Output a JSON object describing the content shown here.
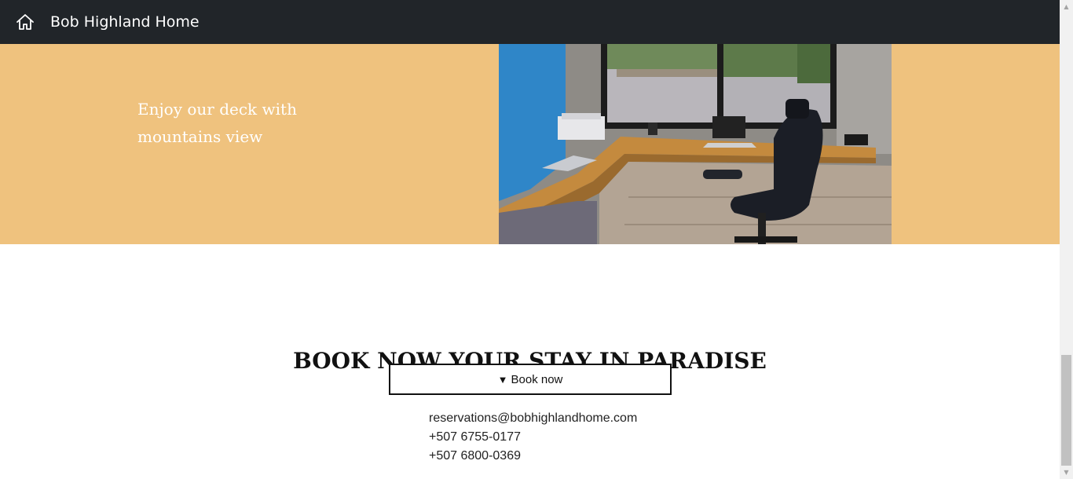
{
  "navbar": {
    "brand": "Bob Highland Home",
    "home_icon": "home-icon",
    "background": "#212529"
  },
  "feature": {
    "text": "Enjoy our deck with mountains view",
    "background": "#efc27e",
    "image": "photo of a home office desk with a black office chair by a window"
  },
  "booking": {
    "title": "BOOK NOW YOUR STAY IN PARADISE",
    "button_caret": "▼",
    "button_label": "Book now"
  },
  "contact": {
    "email": "reservations@bobhighlandhome.com",
    "phone_1": "+507 6755-0177",
    "phone_2": "+507 6800-0369"
  }
}
